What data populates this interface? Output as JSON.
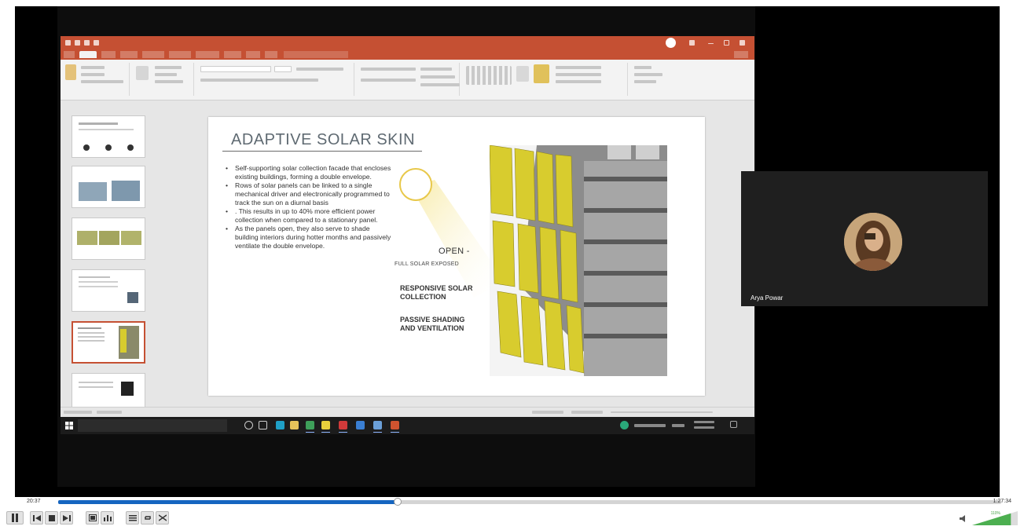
{
  "player": {
    "time_current": "20:37",
    "time_total": "1:27:34",
    "progress_fraction": 0.36,
    "volume_percent_label": "110%",
    "volume_fraction": 0.85,
    "buttons": [
      {
        "name": "pause-button",
        "icon": "pause-icon"
      },
      {
        "name": "previous-button",
        "icon": "skip-previous-icon"
      },
      {
        "name": "stop-button",
        "icon": "stop-icon"
      },
      {
        "name": "next-button",
        "icon": "skip-next-icon"
      },
      {
        "name": "fullscreen-button",
        "icon": "fullscreen-icon"
      },
      {
        "name": "extended-settings-button",
        "icon": "equalizer-icon"
      },
      {
        "name": "playlist-button",
        "icon": "playlist-icon"
      },
      {
        "name": "loop-button",
        "icon": "loop-icon"
      },
      {
        "name": "shuffle-button",
        "icon": "shuffle-icon"
      }
    ],
    "volume_icon": "speaker-icon"
  },
  "participant": {
    "name": "Arya Powar"
  },
  "slide": {
    "title": "ADAPTIVE SOLAR SKIN",
    "bullets": [
      "Self-supporting solar collection facade that encloses existing buildings, forming a double envelope.",
      "Rows of solar panels can be linked to a single mechanical driver and electronically programmed to track the sun on a diurnal basis",
      ". This results in up to 40% more efficient power collection when compared to a stationary panel.",
      "As the panels open, they also serve to shade building interiors during hotter months and passively ventilate the double envelope."
    ],
    "open_label": "OPEN -",
    "open_sub": "FULL SOLAR EXPOSED",
    "callout_responsive": "RESPONSIVE SOLAR\nCOLLECTION",
    "callout_passive": "PASSIVE SHADING\nAND VENTILATION"
  },
  "colors": {
    "ppt_accent": "#c55033",
    "seek_fill": "#1565c0",
    "panel_yellow": "#d8cc2e",
    "stop_sharing": "#4a7fd3"
  }
}
